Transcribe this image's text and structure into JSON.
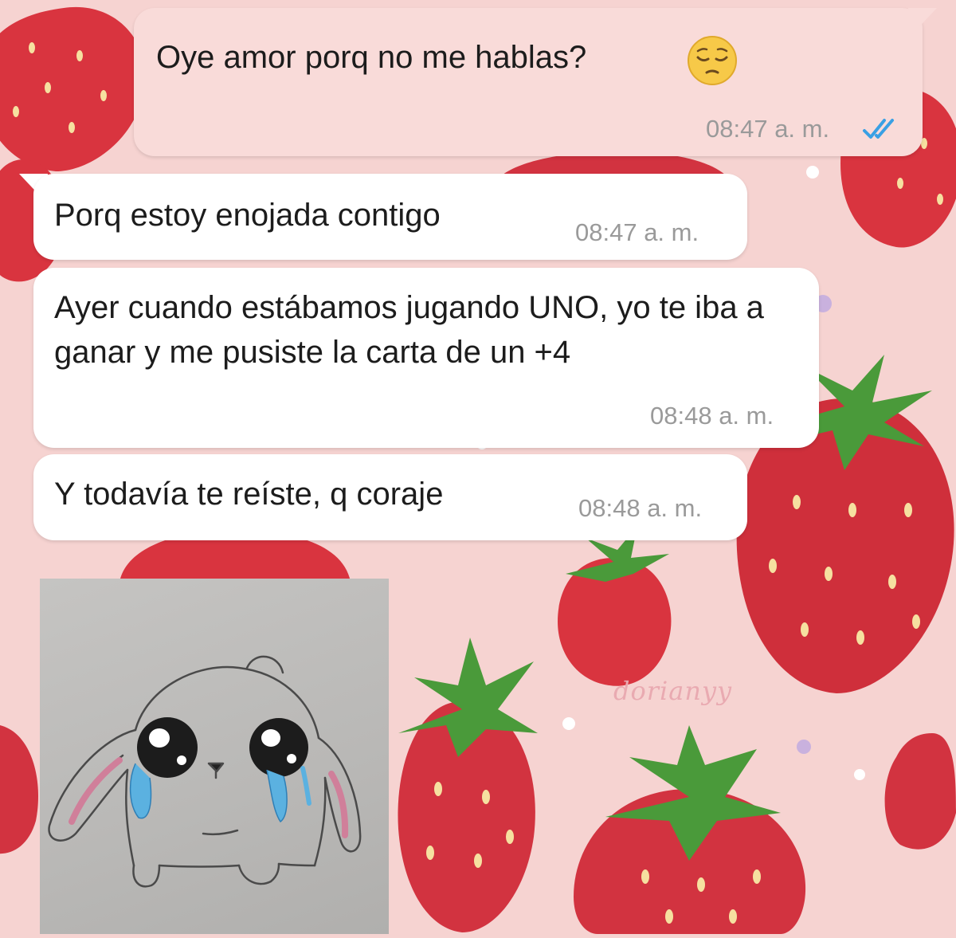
{
  "messages": [
    {
      "direction": "outgoing",
      "text": "Oye amor porq no me hablas?",
      "emoji": "pensive-face",
      "time": "08:47 a. m.",
      "status": "read-double-check"
    },
    {
      "direction": "incoming",
      "text": "Porq estoy enojada contigo",
      "time": "08:47 a. m."
    },
    {
      "direction": "incoming",
      "text": "Ayer cuando estábamos jugando UNO, yo te iba a ganar y me pusiste la carta de un +4",
      "time": "08:48 a. m."
    },
    {
      "direction": "incoming",
      "text": "Y todavía te reíste, q coraje",
      "time": "08:48 a. m."
    }
  ],
  "sticker": {
    "type": "drawing",
    "subject": "crying-bunny"
  },
  "wallpaper": {
    "pattern": "strawberries",
    "watermark": "dorianyy"
  },
  "colors": {
    "background": "#f6d3d1",
    "outgoing_bubble": "#f9dbd9",
    "incoming_bubble": "#ffffff",
    "text": "#1c1c1c",
    "timestamp": "#9a9a9a",
    "read_ticks": "#3aa0e4",
    "strawberry": "#d9343f",
    "leaf": "#4a9a3a"
  }
}
